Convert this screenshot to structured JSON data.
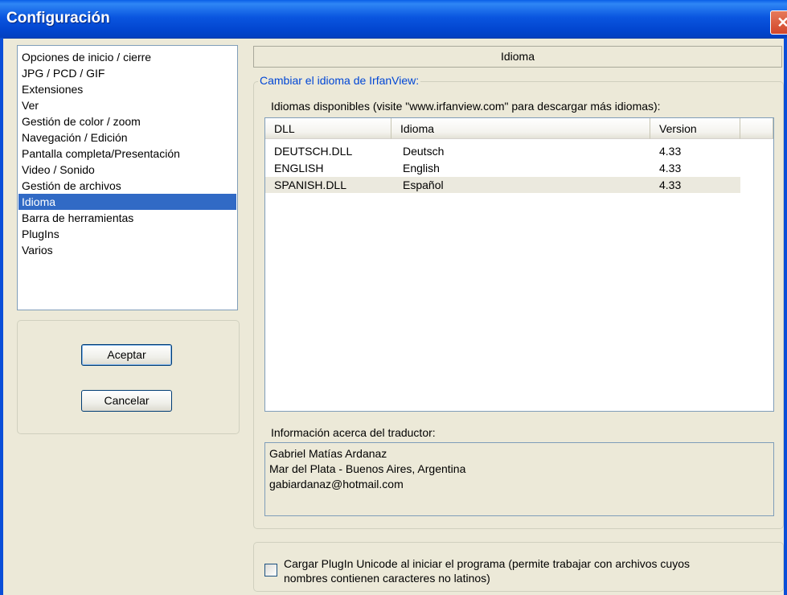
{
  "window": {
    "title": "Configuración",
    "close_glyph": "✕"
  },
  "categories": [
    {
      "label": "Opciones de inicio / cierre"
    },
    {
      "label": "JPG / PCD / GIF"
    },
    {
      "label": "Extensiones"
    },
    {
      "label": "Ver"
    },
    {
      "label": "Gestión de color / zoom"
    },
    {
      "label": "Navegación / Edición"
    },
    {
      "label": "Pantalla completa/Presentación"
    },
    {
      "label": "Video / Sonido"
    },
    {
      "label": "Gestión de archivos"
    },
    {
      "label": "Idioma",
      "selected": true
    },
    {
      "label": "Barra de herramientas"
    },
    {
      "label": "PlugIns"
    },
    {
      "label": "Varios"
    }
  ],
  "buttons": {
    "ok": "Aceptar",
    "cancel": "Cancelar"
  },
  "page": {
    "header": "Idioma",
    "group_title": "Cambiar el idioma de IrfanView:",
    "languages_label": "Idiomas disponibles (visite \"www.irfanview.com\" para descargar más idiomas):",
    "columns": [
      "DLL",
      "Idioma",
      "Version"
    ],
    "rows": [
      {
        "dll": "DEUTSCH.DLL",
        "language": "Deutsch",
        "version": "4.33"
      },
      {
        "dll": "ENGLISH",
        "language": "English",
        "version": "4.33"
      },
      {
        "dll": "SPANISH.DLL",
        "language": "Español",
        "version": "4.33",
        "selected": true
      }
    ],
    "translator_label": "Información acerca del traductor:",
    "translator_lines": [
      "Gabriel Matías Ardanaz",
      "Mar del Plata - Buenos Aires, Argentina",
      "gabiardanaz@hotmail.com"
    ]
  },
  "plugin_option": {
    "checked": false,
    "label_line1": "Cargar PlugIn Unicode al iniciar el programa (permite trabajar con archivos cuyos",
    "label_line2": "nombres contienen caracteres no latinos)"
  },
  "colors": {
    "titlebar": "#0a56e0",
    "selection": "#316ac5",
    "group_title": "#0046d5",
    "dialog_bg": "#ece9d8"
  }
}
